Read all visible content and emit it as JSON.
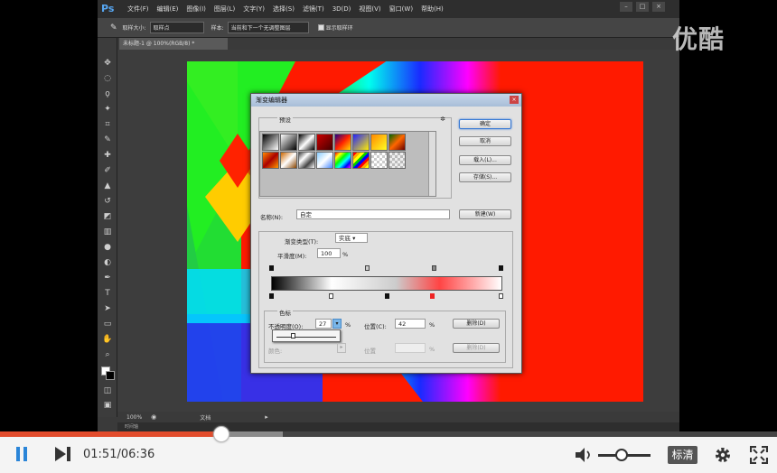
{
  "watermark": "优酷",
  "photoshop": {
    "logo": "Ps",
    "menus": [
      "文件(F)",
      "编辑(E)",
      "图像(I)",
      "图层(L)",
      "文字(Y)",
      "选择(S)",
      "滤镜(T)",
      "3D(D)",
      "视图(V)",
      "窗口(W)",
      "帮助(H)"
    ],
    "window_controls": [
      "–",
      "□",
      "×"
    ],
    "options": {
      "size_label": "取样大小:",
      "size_value": "取样点",
      "sample_label": "样本:",
      "sample_value": "当前和下一个无调整图层",
      "show_ring_label": "显示取样环"
    },
    "doc_tab": "未标题-1 @ 100%(RGB/8) *",
    "status_zoom": "100%",
    "status_center": "文档",
    "timeline_label": "时间轴"
  },
  "dialog": {
    "title": "渐变编辑器",
    "presets_label": "预设",
    "buttons": {
      "ok": "确定",
      "cancel": "取消",
      "load": "载入(L)...",
      "save": "存储(S)...",
      "new": "新建(W)"
    },
    "name_label": "名称(N):",
    "name_value": "自定",
    "gradient_type_label": "渐变类型(T):",
    "gradient_type_value": "实底",
    "smoothness_label": "平滑度(M):",
    "smoothness_value": "100",
    "smoothness_unit": "%",
    "stops_label": "色标",
    "opacity_label": "不透明度(O):",
    "opacity_value": "27",
    "opacity_unit": "%",
    "location_label": "位置(C):",
    "location_value": "42",
    "location_unit": "%",
    "delete_label": "删除(D)",
    "color_label": "颜色:",
    "color_location_label": "位置",
    "color_location_unit": "%",
    "color_delete_label": "删除(D)",
    "slider_level": 0.27
  },
  "player": {
    "current_time": "01:51",
    "total_time": "06:36",
    "time_display": "01:51/06:36",
    "progress": 0.285,
    "buffered": 0.364,
    "quality_label": "标清",
    "volume": 0.45
  },
  "colors": {
    "accent": "#e24c2c",
    "ps_blue": "#57a7f3"
  }
}
